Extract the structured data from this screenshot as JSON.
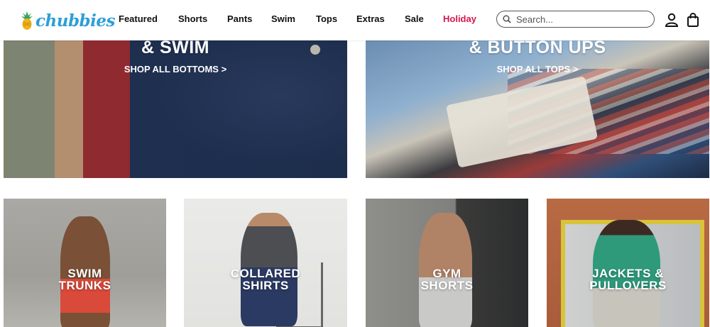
{
  "header": {
    "logo_text": "chubbies",
    "nav": [
      {
        "label": "Featured"
      },
      {
        "label": "Shorts"
      },
      {
        "label": "Pants"
      },
      {
        "label": "Swim"
      },
      {
        "label": "Tops"
      },
      {
        "label": "Extras"
      },
      {
        "label": "Sale"
      },
      {
        "label": "Holiday"
      }
    ],
    "search": {
      "placeholder": "Search..."
    },
    "colors": {
      "logo": "#2d9fd6",
      "holiday": "#d6154f",
      "logo_pineapple": "#f2b21b"
    }
  },
  "hero": [
    {
      "title": "& SWIM",
      "link": "SHOP ALL BOTTOMS >"
    },
    {
      "title": "& BUTTON UPS",
      "link": "SHOP ALL TOPS >"
    }
  ],
  "categories": [
    {
      "line1": "SWIM",
      "line2": "TRUNKS"
    },
    {
      "line1": "COLLARED",
      "line2": "SHIRTS"
    },
    {
      "line1": "GYM",
      "line2": "SHORTS"
    },
    {
      "line1": "JACKETS &",
      "line2": "PULLOVERS"
    }
  ]
}
